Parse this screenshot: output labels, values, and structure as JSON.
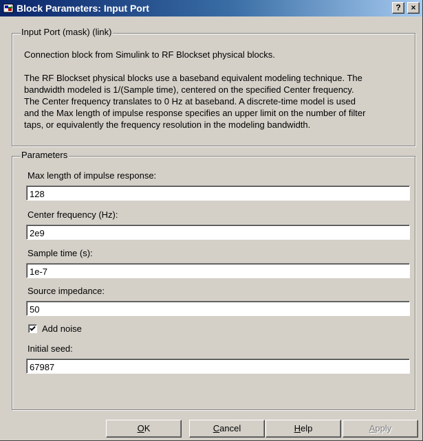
{
  "window": {
    "title": "Block Parameters: Input Port",
    "help_button": "?",
    "close_button": "×",
    "icon": "simulink-block-icon"
  },
  "description_group": {
    "legend": "Input Port (mask) (link)",
    "summary": "Connection block from Simulink to RF Blockset physical blocks.",
    "details": [
      "The RF Blockset physical blocks use a baseband equivalent modeling technique. The",
      "bandwidth modeled is 1/(Sample time), centered on the specified Center frequency.",
      "The Center frequency translates to 0 Hz at baseband. A discrete-time model is used",
      "and the Max length of impulse response specifies an upper limit on the number of filter",
      "taps, or equivalently the frequency resolution in the modeling bandwidth."
    ]
  },
  "parameters_group": {
    "legend": "Parameters",
    "max_length": {
      "label": "Max length of impulse response:",
      "value": "128"
    },
    "center_frequency": {
      "label": "Center frequency (Hz):",
      "value": "2e9"
    },
    "sample_time": {
      "label": "Sample time (s):",
      "value": "1e-7"
    },
    "source_impedance": {
      "label": "Source impedance:",
      "value": "50"
    },
    "add_noise": {
      "label": "Add noise",
      "checked": true
    },
    "initial_seed": {
      "label": "Initial seed:",
      "value": "67987"
    }
  },
  "buttons": {
    "ok": {
      "mnemonic": "O",
      "rest": "K"
    },
    "cancel": {
      "mnemonic": "C",
      "rest": "ancel"
    },
    "help": {
      "mnemonic": "H",
      "rest": "elp"
    },
    "apply": {
      "mnemonic": "A",
      "rest": "pply",
      "enabled": false
    }
  }
}
